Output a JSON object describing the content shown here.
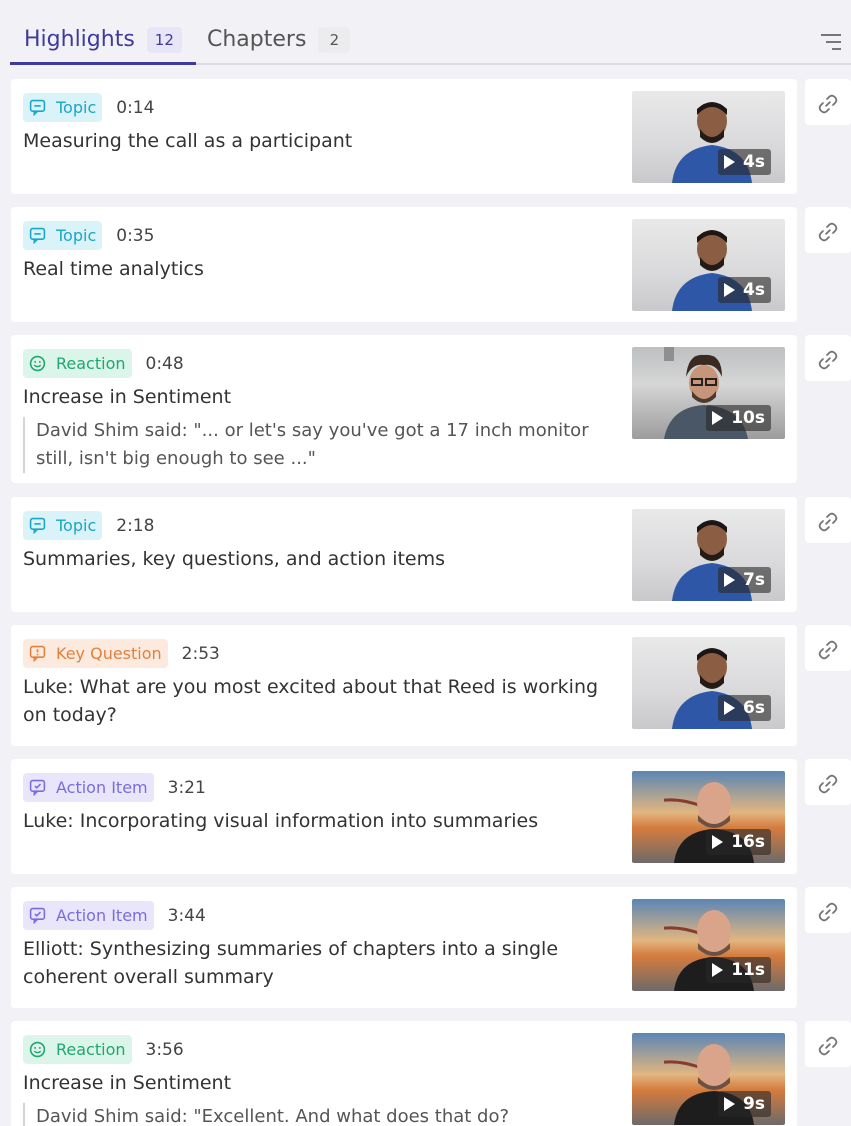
{
  "tabs": [
    {
      "label": "Highlights",
      "count": "12"
    },
    {
      "label": "Chapters",
      "count": "2"
    }
  ],
  "colors": {
    "accent": "#3f3a9c",
    "topic": "#1aa6c6",
    "reaction": "#1fa673",
    "key_question": "#e0813d",
    "action_item": "#7a6cdc"
  },
  "highlights": [
    {
      "type": "Topic",
      "time": "0:14",
      "title": "Measuring the call as a participant",
      "duration": "4s"
    },
    {
      "type": "Topic",
      "time": "0:35",
      "title": "Real time analytics",
      "duration": "4s"
    },
    {
      "type": "Reaction",
      "time": "0:48",
      "title": "Increase in Sentiment",
      "quote": "David Shim said: \"... or let's say you've got a 17 inch monitor still, isn't big enough to see ...\"",
      "duration": "10s"
    },
    {
      "type": "Topic",
      "time": "2:18",
      "title": "Summaries, key questions, and action items",
      "duration": "7s"
    },
    {
      "type": "Key Question",
      "time": "2:53",
      "title": "Luke: What are you most excited about that Reed is working on today?",
      "duration": "6s"
    },
    {
      "type": "Action Item",
      "time": "3:21",
      "title": "Luke: Incorporating visual information into summaries",
      "duration": "16s"
    },
    {
      "type": "Action Item",
      "time": "3:44",
      "title": "Elliott: Synthesizing summaries of chapters into a single coherent overall summary",
      "duration": "11s"
    },
    {
      "type": "Reaction",
      "time": "3:56",
      "title": "Increase in Sentiment",
      "quote": "David Shim said: \"Excellent. And what does that do?",
      "duration": "9s"
    }
  ]
}
